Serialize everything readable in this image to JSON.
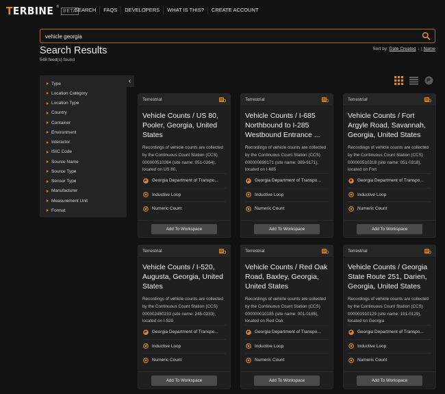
{
  "brand": {
    "name_first": "T",
    "name_rest": "ERBINE",
    "registered": "®",
    "beta": "BETA"
  },
  "nav": {
    "links": [
      "SEARCH",
      "FAQS",
      "DEVELOPERS",
      "WHAT IS THIS?",
      "CREATE ACCOUNT"
    ]
  },
  "search": {
    "value": "vehicle georgia",
    "placeholder": ""
  },
  "results": {
    "title": "Search Results",
    "count": "548 feed(s) found",
    "sort_label": "Sort by:",
    "sort_options": [
      "Date Created",
      "Name"
    ],
    "sort_separator": "|",
    "sort_arrow": "↓"
  },
  "filters": {
    "items": [
      "Type",
      "Location Category",
      "Location Type",
      "Country",
      "Container",
      "Environment",
      "Interactor",
      "ISIC Code",
      "Source Name",
      "Source Type",
      "Sensor Type",
      "Manufacturer",
      "Measurement Unit",
      "Format"
    ],
    "collapse_glyph": "‹"
  },
  "view_toggles": [
    "grid-view",
    "list-view",
    "map-view"
  ],
  "colors": {
    "accent": "#d48a3a",
    "background": "#121212",
    "card": "#1f1f1f"
  },
  "cards": [
    {
      "type": "Terrestrial",
      "title": "Vehicle Counts / US 80, Pooler, Georgia, United States",
      "description": "Recordings of vehicle counts are collected by the Continuous Count Station (CCS) 000000510264 (site name: 051-0264), located on US 80,",
      "source": "Georgia Department of Transpo...",
      "sensor": "Inductive Loop",
      "unit": "Numeric Count",
      "button": "Add To Workspace"
    },
    {
      "type": "Terrestrial",
      "title": "Vehicle Counts / I-685 Northbound to I-285 Westbound Entrance ...",
      "description": "Recordings of vehicle counts are collected by the Continuous Count Station (CCS) 000000899171 (site name: 089-9171), located on I-685",
      "source": "Georgia Department of Transpo...",
      "sensor": "Inductive Loop",
      "unit": "Numeric Count",
      "button": "Add To Workspace"
    },
    {
      "type": "Terrestrial",
      "title": "Vehicle Counts / Fort Argyle Road, Savannah, Georgia, United States",
      "description": "Recordings of vehicle counts are collected by the Continuous Count Station (CCS) 000000510318 (site name: 051-0318), located on Fort",
      "source": "Georgia Department of Transpo...",
      "sensor": "Inductive Loop",
      "unit": "Numeric Count",
      "button": "Add To Workspace"
    },
    {
      "type": "Terrestrial",
      "title": "Vehicle Counts / I-520, Augusta, Georgia, United States",
      "description": "Recordings of vehicle counts are collected by the Continuous Count Station (CCS) 000002450233 (site name: 245-0233), located on I-520",
      "source": "Georgia Department of Transpo...",
      "sensor": "Inductive Loop",
      "unit": "Numeric Count",
      "button": "Add To Workspace"
    },
    {
      "type": "Terrestrial",
      "title": "Vehicle Counts / Red Oak Road, Baxley, Georgia, United States",
      "description": "Recordings of vehicle counts are collected by the Continuous Count Station (CCS) 000000010185 (site name: 001-0185), located on Red Oak",
      "source": "Georgia Department of Transpo...",
      "sensor": "Inductive Loop",
      "unit": "Numeric Count",
      "button": "Add To Workspace"
    },
    {
      "type": "Terrestrial",
      "title": "Vehicle Counts / Georgia State Route 251, Darien, Georgia, United States",
      "description": "Recordings of vehicle counts are collected by the Continuous Count Station (CCS) 000001910129 (site name: 191-0129), located on Georgia",
      "source": "Georgia Department of Transpo...",
      "sensor": "Inductive Loop",
      "unit": "Numeric Count",
      "button": "Add To Workspace"
    }
  ]
}
